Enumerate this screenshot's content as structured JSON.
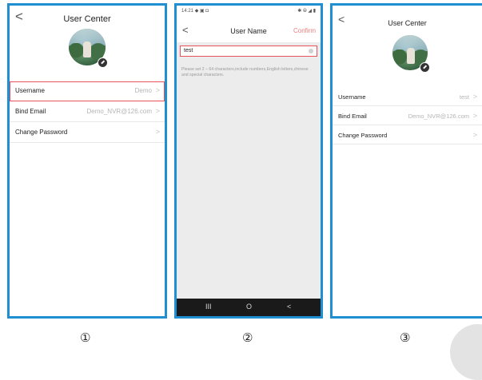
{
  "screens": [
    {
      "title": "User Center",
      "rows": [
        {
          "label": "Username",
          "value": "Demo"
        },
        {
          "label": "Bind Email",
          "value": "Demo_NVR@126.com"
        },
        {
          "label": "Change Password",
          "value": ""
        }
      ],
      "chevron": ">",
      "step": "①"
    },
    {
      "status_time": "14:21",
      "status_icons": "◆ ▣ ◘",
      "status_right": "✱ ⦾ ◢ ▮",
      "title": "User Name",
      "confirm_label": "Confirm",
      "input_value": "test",
      "hint": "Please set 2 – 64 characters,include numbers,English letters,chinese and special characters.",
      "nav": [
        "III",
        "O",
        "<"
      ],
      "step": "②"
    },
    {
      "title": "User Center",
      "rows": [
        {
          "label": "Username",
          "value": "test"
        },
        {
          "label": "Bind Email",
          "value": "Demo_NVR@126.com"
        },
        {
          "label": "Change Password",
          "value": ""
        }
      ],
      "chevron": ">",
      "step": "③"
    }
  ],
  "back_label": "<",
  "colors": {
    "frame": "#1f8fd1",
    "highlight": "#e8505b",
    "confirm": "#ef7c7c"
  }
}
